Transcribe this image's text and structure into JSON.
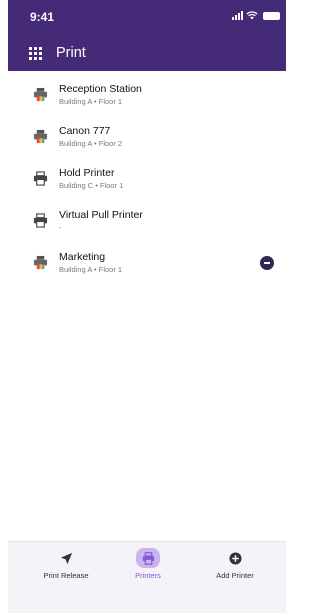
{
  "status": {
    "time": "9:41"
  },
  "header": {
    "title": "Print"
  },
  "printers": [
    {
      "name": "Reception Station",
      "location": "Building A • Floor 1",
      "color": true,
      "removable": false
    },
    {
      "name": "Canon 777",
      "location": "Building A • Floor 2",
      "color": true,
      "removable": false
    },
    {
      "name": "Hold Printer",
      "location": "Building C • Floor 1",
      "color": false,
      "removable": false
    },
    {
      "name": "Virtual Pull Printer",
      "location": "-",
      "color": false,
      "removable": false
    },
    {
      "name": "Marketing",
      "location": "Building A • Floor 1",
      "color": true,
      "removable": true
    }
  ],
  "tabs": [
    {
      "label": "Print Release",
      "icon": "send-icon"
    },
    {
      "label": "Printers",
      "icon": "printer-icon"
    },
    {
      "label": "Add Printer",
      "icon": "plus-circle-icon"
    }
  ],
  "colors": {
    "header": "#452a78",
    "accent": "#8758d6",
    "remove": "#2e2a55"
  }
}
